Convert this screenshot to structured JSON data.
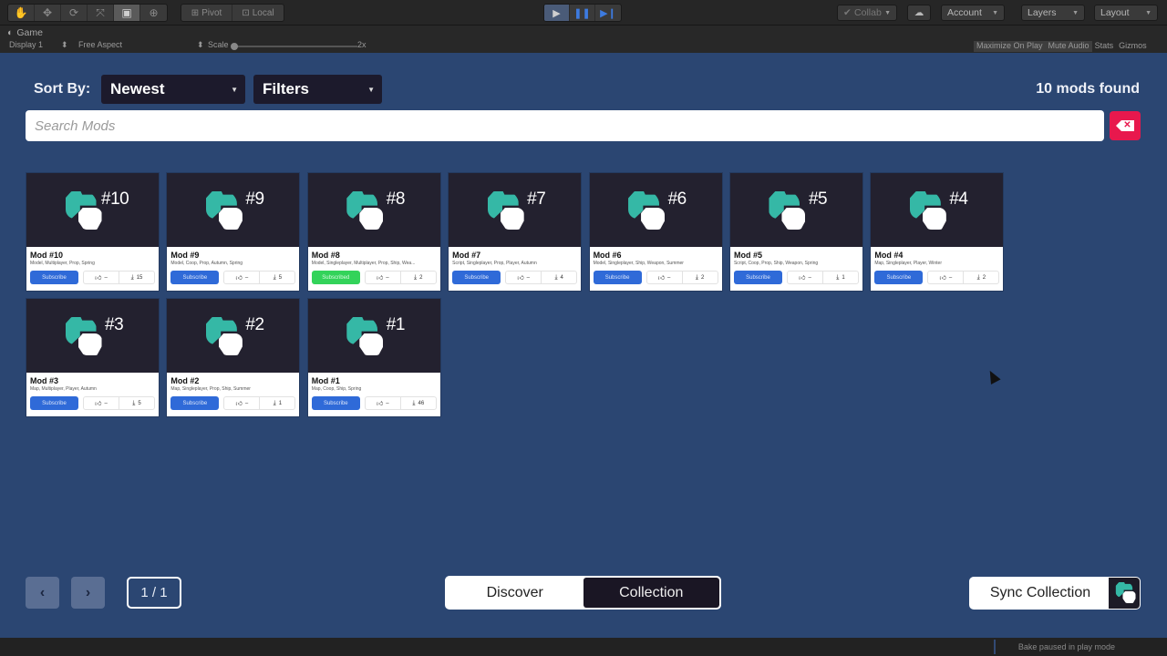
{
  "editor": {
    "tools": [
      "hand-tool",
      "move-tool",
      "rotate-tool",
      "scale-tool",
      "rect-tool",
      "transform-tool"
    ],
    "pivot_label": "Pivot",
    "local_label": "Local",
    "play_controls": [
      "play",
      "pause",
      "step"
    ],
    "collab_label": "Collab",
    "account_label": "Account",
    "layers_label": "Layers",
    "layout_label": "Layout",
    "game_tab_label": "Game",
    "display_label": "Display 1",
    "aspect_label": "Free Aspect",
    "scale_label": "Scale",
    "scale_value": "2x",
    "maximize_label": "Maximize On Play",
    "mute_label": "Mute Audio",
    "stats_label": "Stats",
    "gizmos_label": "Gizmos",
    "status_text": "Bake paused in play mode"
  },
  "browser": {
    "sort_label": "Sort By:",
    "sort_value": "Newest",
    "filters_label": "Filters",
    "count_text": "10 mods found",
    "search_placeholder": "Search Mods",
    "search_value": ""
  },
  "mods": [
    {
      "badge": "#10",
      "title": "Mod #10",
      "tags": "Model, Multiplayer, Prop, Spring",
      "button": "Subscribe",
      "subscribed": false,
      "likes": "–",
      "downloads": "15"
    },
    {
      "badge": "#9",
      "title": "Mod #9",
      "tags": "Model, Coop, Prop, Autumn, Spring",
      "button": "Subscribe",
      "subscribed": false,
      "likes": "–",
      "downloads": "5"
    },
    {
      "badge": "#8",
      "title": "Mod #8",
      "tags": "Model, Singleplayer, Multiplayer, Prop, Ship, Wea...",
      "button": "Subscribed",
      "subscribed": true,
      "likes": "–",
      "downloads": "2"
    },
    {
      "badge": "#7",
      "title": "Mod #7",
      "tags": "Script, Singleplayer, Prop, Player, Autumn",
      "button": "Subscribe",
      "subscribed": false,
      "likes": "–",
      "downloads": "4"
    },
    {
      "badge": "#6",
      "title": "Mod #6",
      "tags": "Model, Singleplayer, Ship, Weapon, Summer",
      "button": "Subscribe",
      "subscribed": false,
      "likes": "–",
      "downloads": "2"
    },
    {
      "badge": "#5",
      "title": "Mod #5",
      "tags": "Script, Coop, Prop, Ship, Weapon, Spring",
      "button": "Subscribe",
      "subscribed": false,
      "likes": "–",
      "downloads": "1"
    },
    {
      "badge": "#4",
      "title": "Mod #4",
      "tags": "Map, Singleplayer, Player, Winter",
      "button": "Subscribe",
      "subscribed": false,
      "likes": "–",
      "downloads": "2"
    },
    {
      "badge": "#3",
      "title": "Mod #3",
      "tags": "Map, Multiplayer, Player, Autumn",
      "button": "Subscribe",
      "subscribed": false,
      "likes": "–",
      "downloads": "5"
    },
    {
      "badge": "#2",
      "title": "Mod #2",
      "tags": "Map, Singleplayer, Prop, Ship, Summer",
      "button": "Subscribe",
      "subscribed": false,
      "likes": "–",
      "downloads": "1"
    },
    {
      "badge": "#1",
      "title": "Mod #1",
      "tags": "Map, Coop, Ship, Spring",
      "button": "Subscribe",
      "subscribed": false,
      "likes": "–",
      "downloads": "46"
    }
  ],
  "footer": {
    "prev_icon": "‹",
    "next_icon": "›",
    "page_indicator": "1 / 1",
    "tab_discover": "Discover",
    "tab_collection": "Collection",
    "active_tab": "Collection",
    "sync_label": "Sync Collection"
  },
  "colors": {
    "background": "#2b4672",
    "subscribe": "#2f6ad8",
    "subscribed": "#33d35a",
    "clear": "#e8184d",
    "logo_teal": "#35b8a6"
  }
}
